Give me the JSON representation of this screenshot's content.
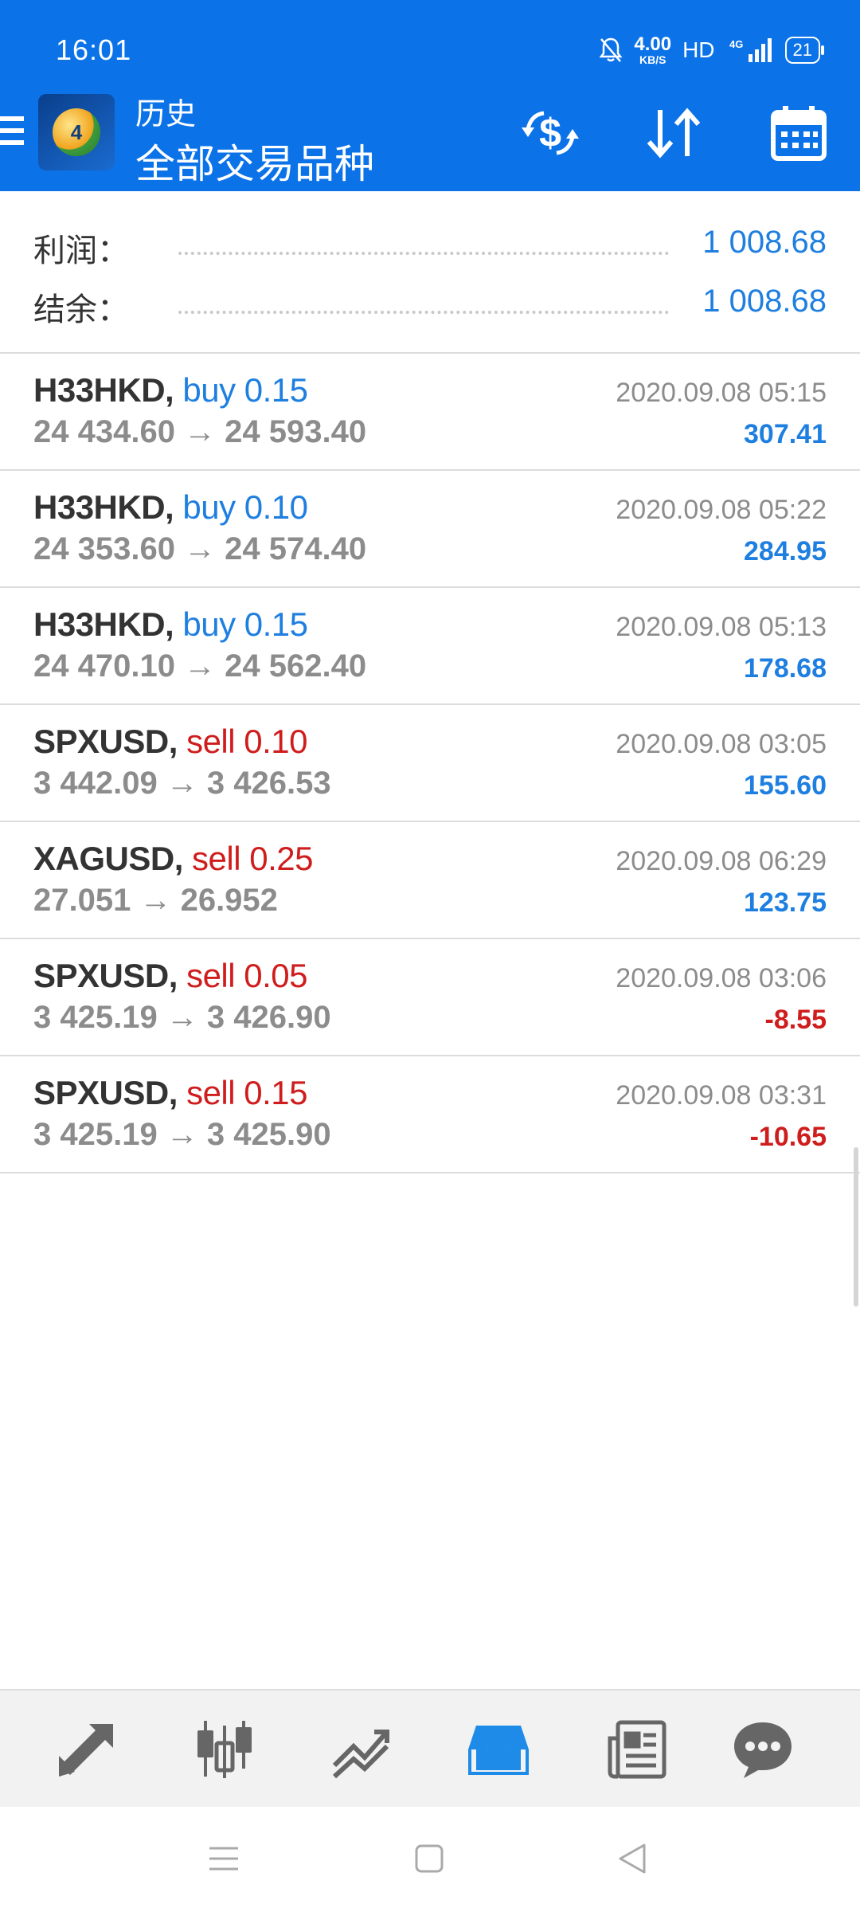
{
  "status_bar": {
    "time": "16:01",
    "net_speed_value": "4.00",
    "net_speed_unit": "KB/S",
    "hd_label": "HD",
    "network_label": "4G",
    "battery": "21"
  },
  "app_bar": {
    "subtitle": "历史",
    "title": "全部交易品种",
    "logo_text": "4"
  },
  "summary": {
    "profit_label": "利润：",
    "profit_value": "1 008.68",
    "balance_label": "结余：",
    "balance_value": "1 008.68"
  },
  "deals": [
    {
      "symbol": "H33HKD,",
      "type": "buy",
      "volume": "buy 0.15",
      "prices": "24 434.60 → 24 593.40",
      "time": "2020.09.08 05:15",
      "profit": "307.41",
      "sign": "pos"
    },
    {
      "symbol": "H33HKD,",
      "type": "buy",
      "volume": "buy 0.10",
      "prices": "24 353.60 → 24 574.40",
      "time": "2020.09.08 05:22",
      "profit": "284.95",
      "sign": "pos"
    },
    {
      "symbol": "H33HKD,",
      "type": "buy",
      "volume": "buy 0.15",
      "prices": "24 470.10 → 24 562.40",
      "time": "2020.09.08 05:13",
      "profit": "178.68",
      "sign": "pos"
    },
    {
      "symbol": "SPXUSD,",
      "type": "sell",
      "volume": "sell 0.10",
      "prices": "3 442.09 → 3 426.53",
      "time": "2020.09.08 03:05",
      "profit": "155.60",
      "sign": "pos"
    },
    {
      "symbol": "XAGUSD,",
      "type": "sell",
      "volume": "sell 0.25",
      "prices": "27.051 → 26.952",
      "time": "2020.09.08 06:29",
      "profit": "123.75",
      "sign": "pos"
    },
    {
      "symbol": "SPXUSD,",
      "type": "sell",
      "volume": "sell 0.05",
      "prices": "3 425.19 → 3 426.90",
      "time": "2020.09.08 03:06",
      "profit": "-8.55",
      "sign": "neg"
    },
    {
      "symbol": "SPXUSD,",
      "type": "sell",
      "volume": "sell 0.15",
      "prices": "3 425.19 → 3 425.90",
      "time": "2020.09.08 03:31",
      "profit": "-10.65",
      "sign": "neg"
    }
  ],
  "colors": {
    "primary": "#0b72e8",
    "positive": "#1e7fe0",
    "negative": "#cf1d1d"
  },
  "icons": {
    "app_bar": [
      "menu-icon",
      "mt4-logo",
      "currency-exchange-icon",
      "sort-icon",
      "calendar-icon"
    ],
    "bottom_nav": [
      "quotes-icon",
      "chart-icon",
      "trade-icon",
      "history-icon",
      "news-icon",
      "chat-icon"
    ],
    "bottom_nav_active": "history-icon",
    "system_nav": [
      "recent-apps-icon",
      "home-icon",
      "back-icon"
    ]
  }
}
